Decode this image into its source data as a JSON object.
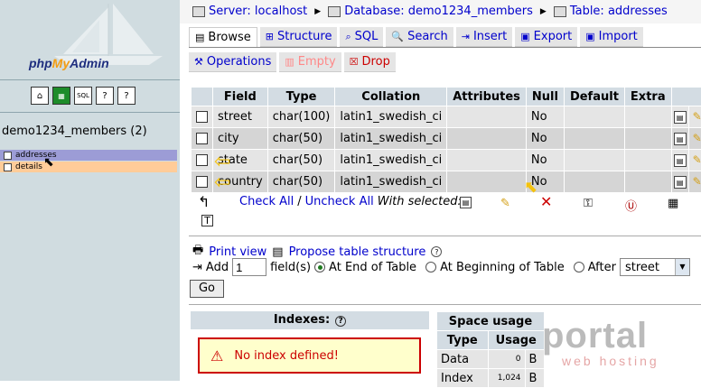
{
  "left": {
    "logo": "phpMyAdmin",
    "logo_parts": [
      "php",
      "My",
      "Admin"
    ],
    "icons": [
      "home-icon",
      "sql-window-icon",
      "sql-icon",
      "docs-icon",
      "help-icon"
    ],
    "database": "demo1234_members (2)",
    "tables": [
      "addresses",
      "details"
    ]
  },
  "breadcrumb": {
    "server": "Server: localhost",
    "database": "Database: demo1234_members",
    "table": "Table: addresses"
  },
  "tabs_row1": [
    {
      "label": "Browse",
      "active": true
    },
    {
      "label": "Structure"
    },
    {
      "label": "SQL"
    },
    {
      "label": "Search"
    },
    {
      "label": "Insert"
    },
    {
      "label": "Export"
    },
    {
      "label": "Import"
    }
  ],
  "tabs_row2": [
    {
      "label": "Operations"
    },
    {
      "label": "Empty"
    },
    {
      "label": "Drop"
    }
  ],
  "structure": {
    "headers": [
      "Field",
      "Type",
      "Collation",
      "Attributes",
      "Null",
      "Default",
      "Extra"
    ],
    "rows": [
      {
        "field": "street",
        "type": "char(100)",
        "collation": "latin1_swedish_ci",
        "attributes": "",
        "null": "No",
        "default": "",
        "extra": ""
      },
      {
        "field": "city",
        "type": "char(50)",
        "collation": "latin1_swedish_ci",
        "attributes": "",
        "null": "No",
        "default": "",
        "extra": ""
      },
      {
        "field": "state",
        "type": "char(50)",
        "collation": "latin1_swedish_ci",
        "attributes": "",
        "null": "No",
        "default": "",
        "extra": ""
      },
      {
        "field": "country",
        "type": "char(50)",
        "collation": "latin1_swedish_ci",
        "attributes": "",
        "null": "No",
        "default": "",
        "extra": ""
      }
    ],
    "check_all": "Check All",
    "separator": "/",
    "uncheck_all": "Uncheck All",
    "with_selected": "With selected:"
  },
  "tools": {
    "print_view": "Print view",
    "propose": "Propose table structure",
    "add": "Add",
    "add_value": "1",
    "fields": "field(s)",
    "end": "At End of Table",
    "beginning": "At Beginning of Table",
    "after": "After",
    "after_value": "street",
    "go": "Go"
  },
  "indexes": {
    "title": "Indexes:",
    "message": "No index defined!"
  },
  "space": {
    "title": "Space usage",
    "headers": [
      "Type",
      "Usage"
    ],
    "rows": [
      {
        "type": "Data",
        "usage": "0",
        "unit": "B"
      },
      {
        "type": "Index",
        "usage": "1,024",
        "unit": "B"
      }
    ]
  },
  "watermark": {
    "big": "portal",
    "small": "web hosting"
  }
}
